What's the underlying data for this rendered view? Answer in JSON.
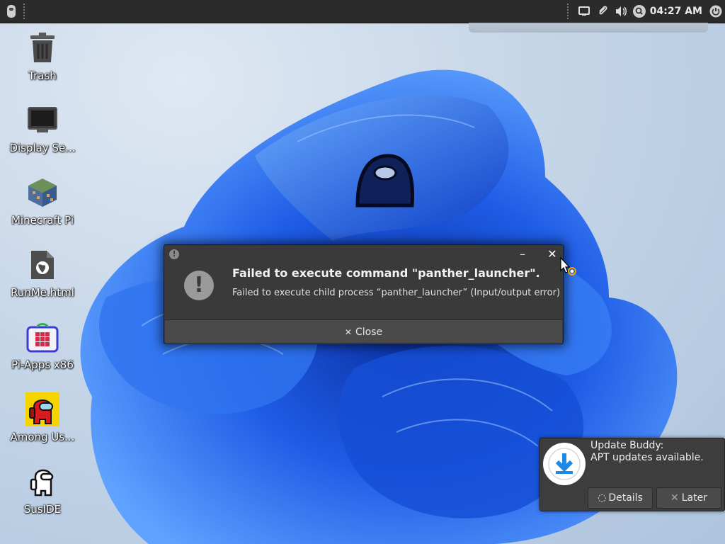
{
  "panel": {
    "clock": "04:27 AM"
  },
  "desktop": {
    "icons": [
      {
        "label": "Trash"
      },
      {
        "label": "Display Se..."
      },
      {
        "label": "Minecraft Pi"
      },
      {
        "label": "RunMe.html"
      },
      {
        "label": "Pi-Apps x86"
      },
      {
        "label": "Among Us..."
      },
      {
        "label": "SusIDE"
      }
    ]
  },
  "dialog": {
    "small_icon": "!",
    "minimize": "–",
    "close_x": "✕",
    "icon": "!",
    "title": "Failed to execute command \"panther_launcher\".",
    "message": "Failed to execute child process “panther_launcher” (Input/output error)",
    "close_button": "Close",
    "close_button_icon": "✕"
  },
  "notification": {
    "title": "Update Buddy:",
    "body": "APT updates available.",
    "details_button": "Details",
    "details_icon": "◌",
    "later_button": "Later",
    "later_icon": "✕"
  },
  "colors": {
    "panel": "#2b2b2b",
    "dialog_bg": "#3a3a3a",
    "wallpaper_blue": "#1f5fe0"
  }
}
